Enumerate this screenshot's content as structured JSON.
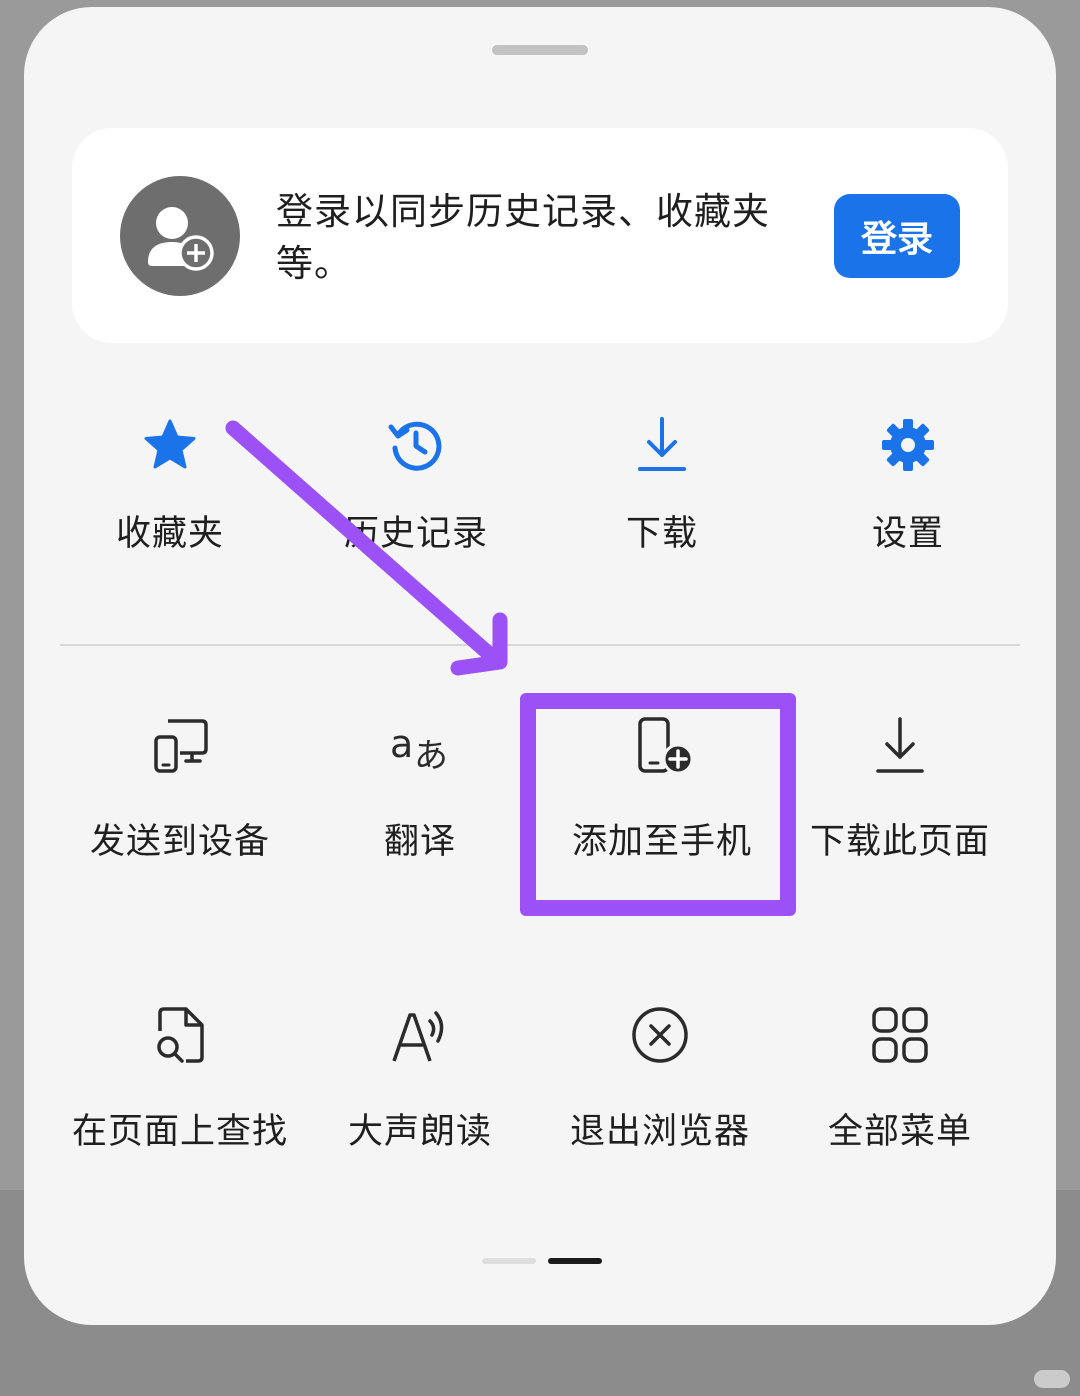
{
  "login_card": {
    "message": "登录以同步历史记录、收藏夹等。",
    "login_button": "登录"
  },
  "quick_actions": [
    {
      "label": "收藏夹",
      "icon": "star-icon"
    },
    {
      "label": "历史记录",
      "icon": "history-icon"
    },
    {
      "label": "下载",
      "icon": "download-icon"
    },
    {
      "label": "设置",
      "icon": "gear-icon"
    }
  ],
  "tools_row1": [
    {
      "label": "发送到设备",
      "icon": "send-to-device-icon"
    },
    {
      "label": "翻译",
      "icon": "translate-icon"
    },
    {
      "label": "添加至手机",
      "icon": "add-to-phone-icon"
    },
    {
      "label": "下载此页面",
      "icon": "download-page-icon"
    }
  ],
  "tools_row2": [
    {
      "label": "在页面上查找",
      "icon": "find-in-page-icon"
    },
    {
      "label": "大声朗读",
      "icon": "read-aloud-icon"
    },
    {
      "label": "退出浏览器",
      "icon": "close-circle-icon"
    },
    {
      "label": "全部菜单",
      "icon": "grid-menu-icon"
    }
  ],
  "page_indicator": {
    "pages": 2,
    "active_index": 1
  },
  "colors": {
    "accent": "#1a73e8",
    "annotation": "#9b51f5",
    "sheet_bg": "#f5f5f5",
    "card_bg": "#ffffff"
  }
}
